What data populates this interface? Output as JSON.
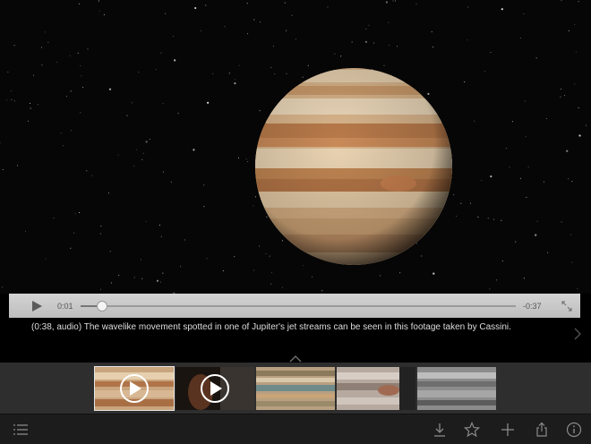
{
  "player": {
    "current_time": "0:01",
    "remaining_time": "-0:37",
    "progress": 0.05
  },
  "caption": {
    "text": "(0:38, audio) The wavelike movement spotted in one of Jupiter's jet streams can be seen in this footage taken by Cassini."
  },
  "icons": {
    "play": "play-icon",
    "expand": "fullscreen-icon",
    "next": "chevron-right-icon",
    "collapse": "chevron-up-icon",
    "list": "list-icon",
    "download": "download-icon",
    "favorite": "star-icon",
    "add": "plus-icon",
    "share": "share-icon",
    "info": "info-icon"
  },
  "thumbnails": [
    {
      "kind": "jupiter-clouds",
      "has_play": true,
      "selected": true
    },
    {
      "kind": "person-dark",
      "has_play": true,
      "selected": false
    },
    {
      "kind": "bands-color",
      "has_play": false,
      "selected": false
    },
    {
      "kind": "bands-storm",
      "has_play": false,
      "selected": false
    },
    {
      "kind": "bands-gray",
      "has_play": false,
      "selected": false
    }
  ],
  "colors": {
    "controls_bg": "#c8c8c8",
    "strip_bg": "#2e2e2e",
    "toolbar_bg": "#1c1c1c"
  }
}
